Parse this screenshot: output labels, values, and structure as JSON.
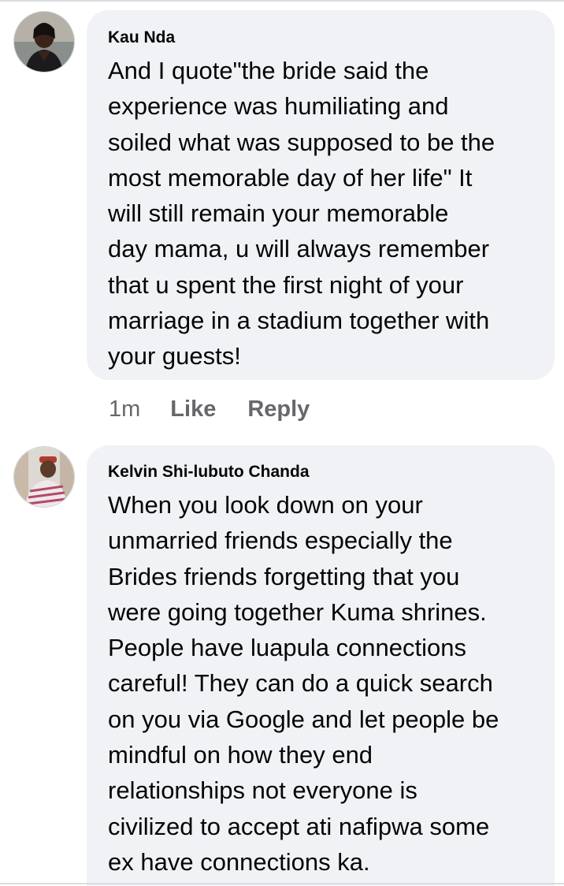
{
  "comments": [
    {
      "author": "Kau Nda",
      "text": "And I quote\"the bride said the\nexperience was humiliating and\nsoiled what was supposed to be the\nmost memorable day of her life\"  It\nwill still remain your memorable\nday mama, u will always remember\nthat u spent the first night of your\nmarriage in a stadium together with\nyour guests!",
      "time": "1m",
      "like_label": "Like",
      "reply_label": "Reply"
    },
    {
      "author": "Kelvin Shi-lubuto Chanda",
      "text": "When you look down on your\nunmarried friends especially the\nBrides friends forgetting that you\nwere going together Kuma shrines.\nPeople have luapula connections\ncareful! They can do a quick search\non you via Google and let people be\nmindful on how they end\nrelationships not everyone is\ncivilized to accept ati nafipwa some\nex have connections ka."
    }
  ],
  "colors": {
    "bubble_bg": "#f0f2f5",
    "text": "#050505",
    "meta": "#65676b"
  },
  "icons": {
    "avatar_1": "profile-photo-woman",
    "avatar_2": "profile-photo-man"
  }
}
